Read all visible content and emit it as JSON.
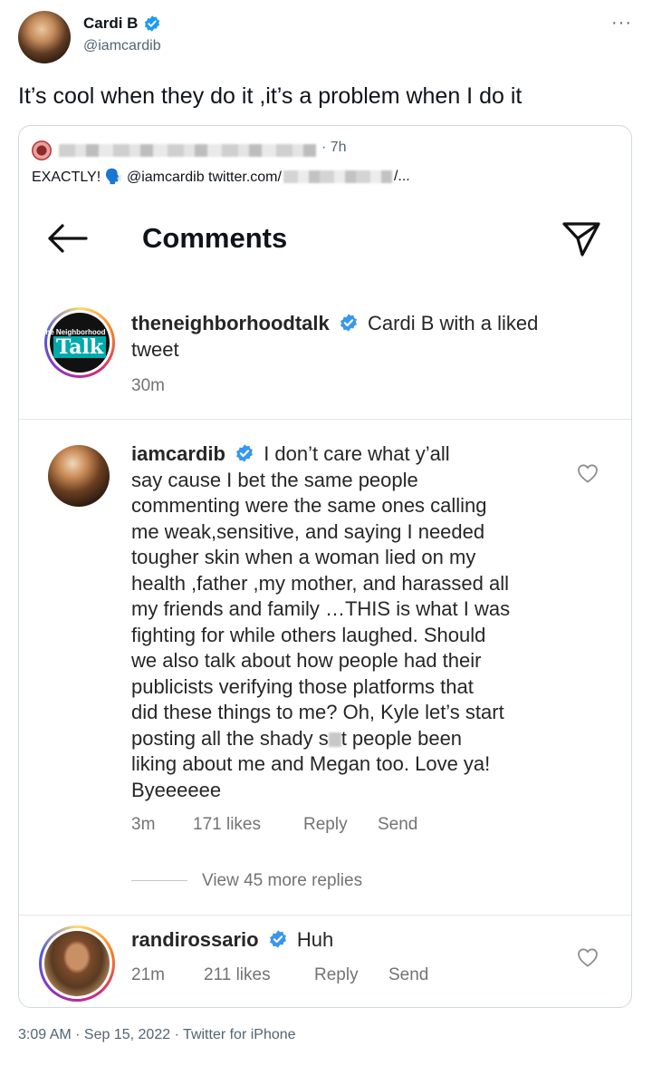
{
  "tweet": {
    "author_name": "Cardi B",
    "author_handle": "@iamcardib",
    "more_label": "···",
    "text": "It’s cool when they do it ,it’s a problem when I do it",
    "footer": "3:09 AM · Sep 15, 2022 · Twitter for iPhone"
  },
  "quote": {
    "time": "· 7h",
    "text_prefix": "EXACTLY! 🗣️ @iamcardib  twitter.com/",
    "text_suffix": "/..."
  },
  "instagram": {
    "title": "Comments",
    "caption": {
      "username": "theneighborhoodtalk",
      "text_line1": "Cardi B with a liked",
      "text_line2": "tweet",
      "time": "30m",
      "logo_small": "The Neighborhood",
      "logo_big": "Talk"
    },
    "comments": [
      {
        "username": "iamcardib",
        "lines": [
          "I don’t care what y’all",
          "say cause I bet the same people",
          "commenting were the same ones calling",
          "me weak,sensitive, and saying I needed",
          "tougher skin when a woman lied on my",
          "health ,father ,my mother, and harassed all",
          "my friends and family …THIS is what I was",
          "fighting for while others laughed. Should",
          "we also talk about how people had their",
          "publicists verifying those platforms that",
          "did these things to me? Oh, Kyle let’s start",
          "posting all the shady s",
          "t people been",
          "liking about me and Megan too. Love ya!",
          "Byeeeeee"
        ],
        "time": "3m",
        "likes": "171 likes",
        "reply": "Reply",
        "send": "Send"
      },
      {
        "username": "randirossario",
        "text": "Huh",
        "time": "21m",
        "likes": "211 likes",
        "reply": "Reply",
        "send": "Send"
      }
    ],
    "view_replies": "View 45 more replies"
  },
  "colors": {
    "verified_blue": "#1d9bf0",
    "ig_verified_blue": "#3897f0",
    "text_gray": "#536471"
  }
}
